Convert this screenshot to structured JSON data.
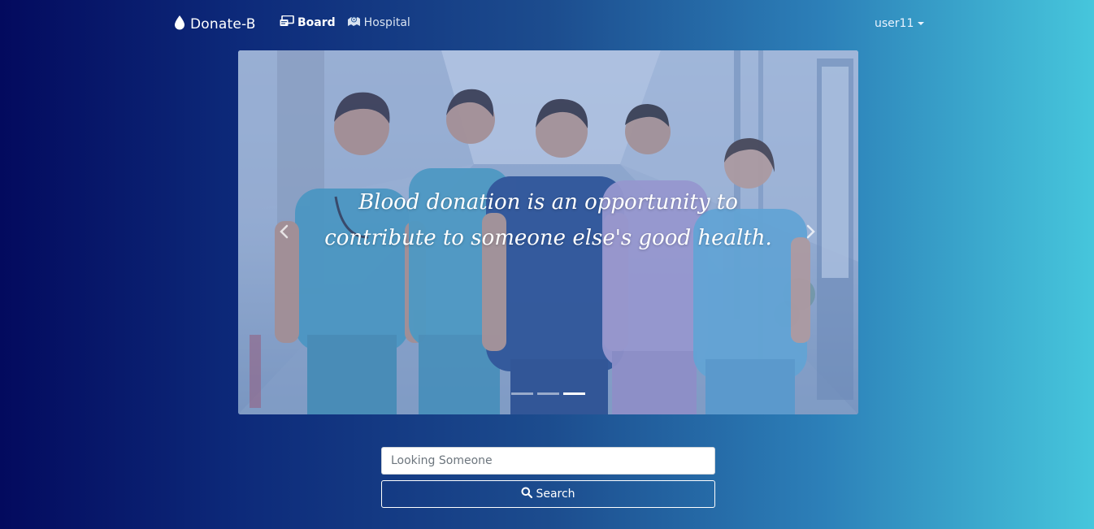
{
  "navbar": {
    "brand": {
      "icon": "blood-drop-icon",
      "label": "Donate-B"
    },
    "links": [
      {
        "icon": "board-icon",
        "label": "Board"
      },
      {
        "icon": "hospital-icon",
        "label": "Hospital"
      }
    ],
    "user": {
      "label": "user11",
      "icon": "caret-down-icon"
    }
  },
  "carousel": {
    "caption_line1": "Blood donation is an opportunity to",
    "caption_line2": "contribute to someone else's good health.",
    "prev_icon": "chevron-left-icon",
    "next_icon": "chevron-right-icon",
    "slide_count": 3,
    "active_slide": 3
  },
  "search": {
    "placeholder": "Looking Someone",
    "value": "",
    "button_icon": "search-icon",
    "button_label": "Search"
  },
  "colors": {
    "gradient_left": "#030a5e",
    "gradient_mid": "#1c4c8e",
    "gradient_right": "#46c6dc",
    "scrub_teal": "#4fa6c4",
    "scrub_navy": "#2c4f8e",
    "scrub_lavender": "#b6a7d6",
    "scrub_light": "#6fb8de"
  }
}
